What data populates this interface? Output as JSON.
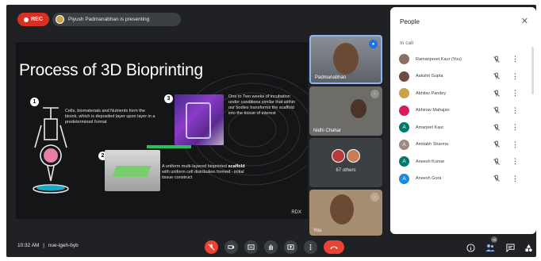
{
  "topbar": {
    "rec_label": "REC",
    "presenting_text": "Piyush Padmanabhan is presenting"
  },
  "slide": {
    "title": "Process of 3D Bioprinting",
    "step1_text": "Cells, biomaterials and Nutrients form the bioink, which is deposited layer upon layer in a predetermined format",
    "step2_text": "A uniform multi-layered bioprinted scaffold with uniform cell distribution formed - initial tissue construct",
    "step2_bold": "scaffold",
    "step3_text": "One to Two weeks of incubation under conditions similar that within our bodies transforms the scaffold into the tissue of interest",
    "badge1": "1",
    "badge2": "2",
    "badge3": "3",
    "watermark": "RDX"
  },
  "tiles": {
    "t1_name": "Padmanabhan",
    "t2_name": "Nidhi Chahar",
    "t3_label": "67 others",
    "t4_name": "You"
  },
  "people_panel": {
    "title": "People",
    "close": "✕",
    "section": "In call",
    "people": [
      {
        "name": "Ramanpreet Kaur (You)",
        "initial": "",
        "color": "#8d6e63"
      },
      {
        "name": "Aakshit Gupta",
        "initial": "",
        "color": "#6d4c41"
      },
      {
        "name": "Abhilav Pandey",
        "initial": "",
        "color": "#c9a24a"
      },
      {
        "name": "Abhinav Mahajan",
        "initial": "",
        "color": "#d81b60"
      },
      {
        "name": "Amarjeet Kaur",
        "initial": "A",
        "color": "#00796b"
      },
      {
        "name": "Amitabh Sharma",
        "initial": "A",
        "color": "#a1887f"
      },
      {
        "name": "Aneesh Kumar",
        "initial": "A",
        "color": "#00796b"
      },
      {
        "name": "Aneesh Gora",
        "initial": "A",
        "color": "#1e88e5"
      }
    ]
  },
  "bottombar": {
    "time": "10:32 AM",
    "separator": "|",
    "meeting_code": "nue-igeh-byb",
    "participants_count": "70"
  },
  "colors": {
    "accent": "#1a73e8",
    "danger": "#ea4335",
    "bar_bg": "#202124"
  }
}
